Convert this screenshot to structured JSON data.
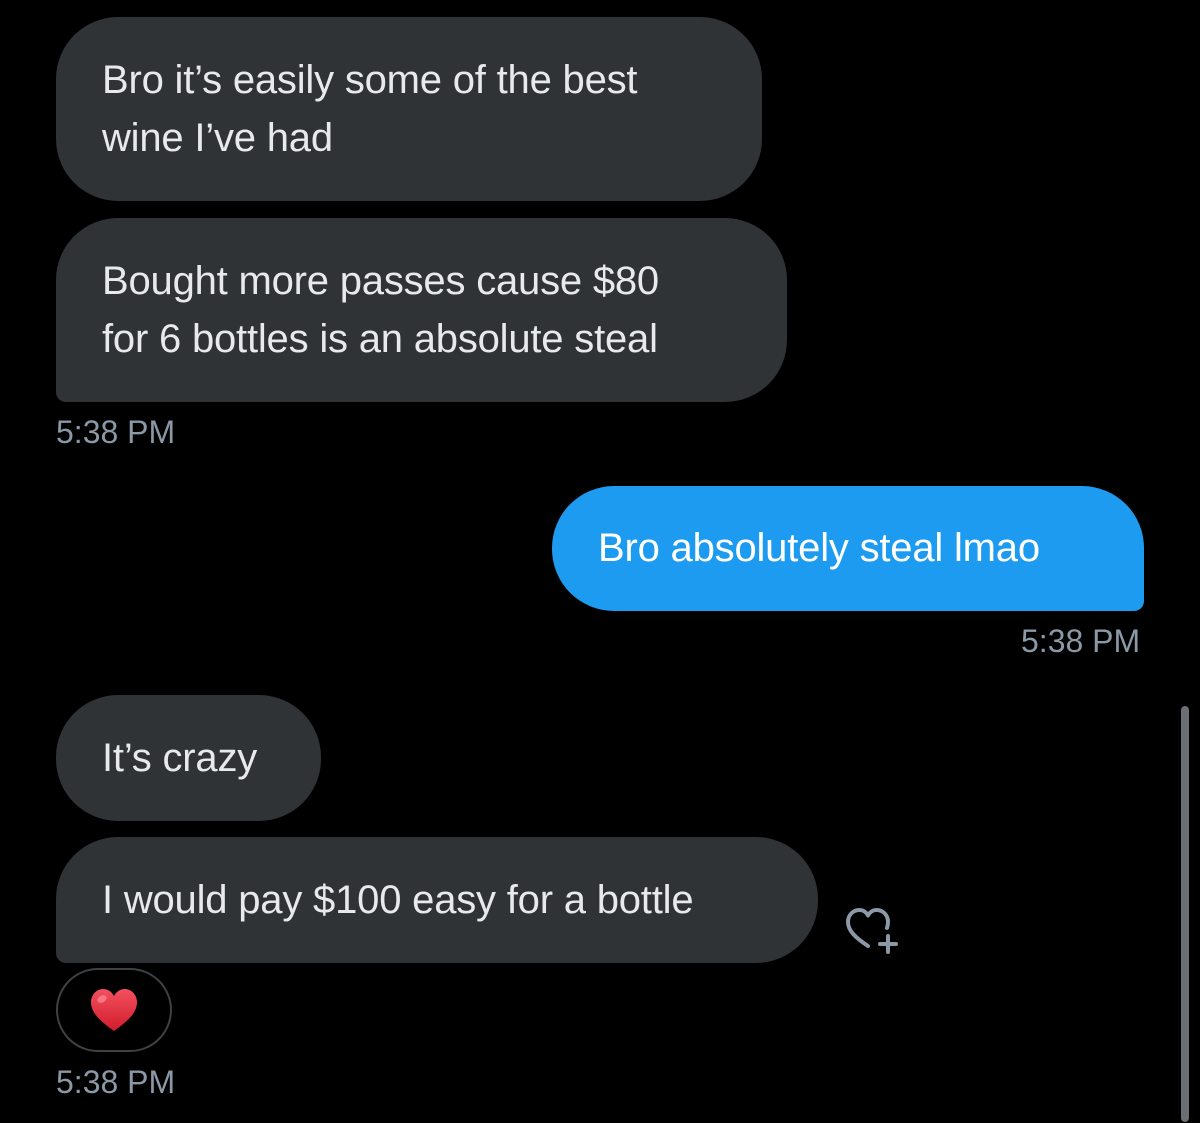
{
  "messages": [
    {
      "direction": "incoming",
      "lines": [
        "Bro it’s easily some of the best",
        "wine I’ve had"
      ]
    },
    {
      "direction": "incoming",
      "lines": [
        "Bought more passes cause $80",
        "for 6 bottles is an absolute steal"
      ],
      "timestamp": "5:38 PM"
    },
    {
      "direction": "outgoing",
      "lines": [
        "Bro absolutely steal lmao"
      ],
      "timestamp": "5:38 PM"
    },
    {
      "direction": "incoming",
      "lines": [
        "It’s crazy"
      ]
    },
    {
      "direction": "incoming",
      "lines": [
        "I would pay $100 easy for a bottle"
      ],
      "reaction": "❤️",
      "timestamp": "5:38 PM"
    }
  ],
  "icons": {
    "add_reaction": "heart-plus-icon",
    "reaction": "red-heart-icon"
  },
  "colors": {
    "background": "#000000",
    "incoming_bubble": "#2f3336",
    "outgoing_bubble": "#1d9bf0",
    "timestamp": "#8b98a5",
    "heart": "#e0245e"
  }
}
